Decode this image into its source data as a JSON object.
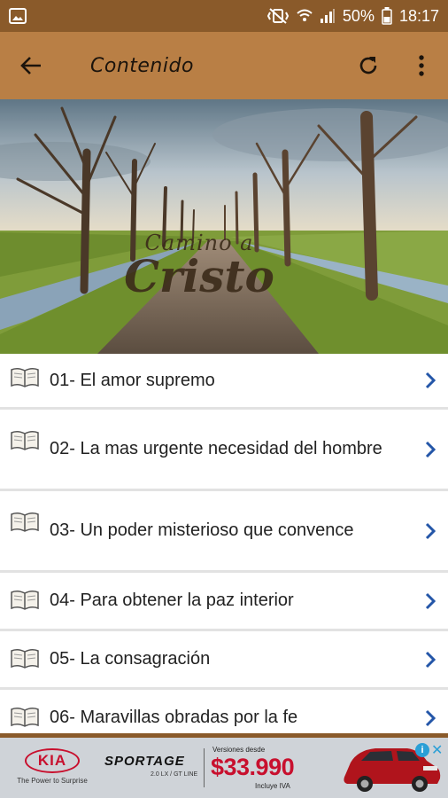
{
  "status_bar": {
    "battery": "50%",
    "time": "18:17"
  },
  "toolbar": {
    "title": "Contenido"
  },
  "hero": {
    "logo_line1": "Camino a",
    "logo_line2": "Cristo"
  },
  "chapters": [
    {
      "label": "01- El amor supremo"
    },
    {
      "label": "02- La mas urgente necesidad del hombre"
    },
    {
      "label": "03- Un poder misterioso que convence"
    },
    {
      "label": "04- Para obtener la paz interior"
    },
    {
      "label": "05- La consagración"
    },
    {
      "label": "06- Maravillas obradas por la fe"
    }
  ],
  "ad": {
    "brand": "KIA",
    "tagline": "The Power to Surprise",
    "model": "SPORTAGE",
    "trims": "2.0 LX / GT LINE",
    "from_label": "Versiones desde",
    "price": "$33.990",
    "tax_note": "Incluye IVA",
    "brand_color": "#c8102e"
  },
  "colors": {
    "status_bar": "#8a5a2a",
    "toolbar": "#b97f45",
    "chevron": "#2456a8"
  }
}
